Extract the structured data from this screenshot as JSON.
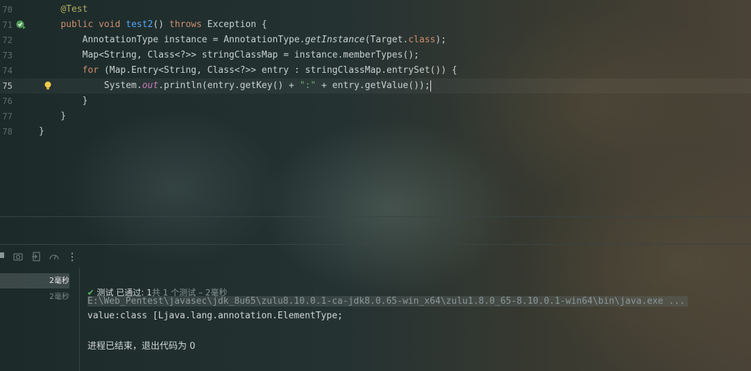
{
  "editor": {
    "lines": [
      {
        "num": "70",
        "parts": [
          {
            "t": "    ",
            "c": ""
          },
          {
            "t": "@Test",
            "c": "ann"
          }
        ]
      },
      {
        "num": "71",
        "parts": [
          {
            "t": "    ",
            "c": ""
          },
          {
            "t": "public",
            "c": "kw"
          },
          {
            "t": " ",
            "c": ""
          },
          {
            "t": "void",
            "c": "kw"
          },
          {
            "t": " ",
            "c": ""
          },
          {
            "t": "test2",
            "c": "fn"
          },
          {
            "t": "() ",
            "c": ""
          },
          {
            "t": "throws",
            "c": "kw"
          },
          {
            "t": " Exception {",
            "c": ""
          }
        ]
      },
      {
        "num": "72",
        "parts": [
          {
            "t": "        AnnotationType instance = AnnotationType.",
            "c": ""
          },
          {
            "t": "getInstance",
            "c": "it"
          },
          {
            "t": "(Target.",
            "c": ""
          },
          {
            "t": "class",
            "c": "kw"
          },
          {
            "t": ");",
            "c": ""
          }
        ]
      },
      {
        "num": "73",
        "parts": [
          {
            "t": "        Map<String, Class<?>> stringClassMap = instance.memberTypes();",
            "c": ""
          }
        ]
      },
      {
        "num": "74",
        "parts": [
          {
            "t": "        ",
            "c": ""
          },
          {
            "t": "for",
            "c": "kw"
          },
          {
            "t": " (Map.Entry<String, Class<?>> entry : stringClassMap.entrySet()) {",
            "c": ""
          }
        ]
      },
      {
        "num": "75",
        "parts": [
          {
            "t": "            System.",
            "c": ""
          },
          {
            "t": "out",
            "c": "static-field"
          },
          {
            "t": ".println(entry.getKey() + ",
            "c": ""
          },
          {
            "t": "\":\"",
            "c": "str"
          },
          {
            "t": " + entry.getValue());",
            "c": ""
          }
        ]
      },
      {
        "num": "76",
        "parts": [
          {
            "t": "        }",
            "c": ""
          }
        ]
      },
      {
        "num": "77",
        "parts": [
          {
            "t": "    }",
            "c": ""
          }
        ]
      },
      {
        "num": "78",
        "parts": [
          {
            "t": "}",
            "c": ""
          }
        ]
      }
    ],
    "current_line": "75"
  },
  "toolbar": {
    "icons": [
      "stop-icon",
      "camera-icon",
      "export-icon",
      "coverage-icon",
      "more-icon"
    ]
  },
  "test_tree": {
    "rows": [
      {
        "time": "2毫秒",
        "selected": true
      },
      {
        "time": "2毫秒",
        "selected": false
      }
    ]
  },
  "status": {
    "label": "测试 已通过:",
    "passed": "1",
    "total_text": "共 1 个测试 – 2毫秒"
  },
  "console": {
    "command": "E:\\Web_Pentest\\javasec\\jdk_8u65\\zulu8.10.0.1-ca-jdk8.0.65-win_x64\\zulu1.8.0_65-8.10.0.1-win64\\bin\\java.exe ...",
    "output": "value:class [Ljava.lang.annotation.ElementType;",
    "exit": "进程已结束，退出代码为 0"
  }
}
